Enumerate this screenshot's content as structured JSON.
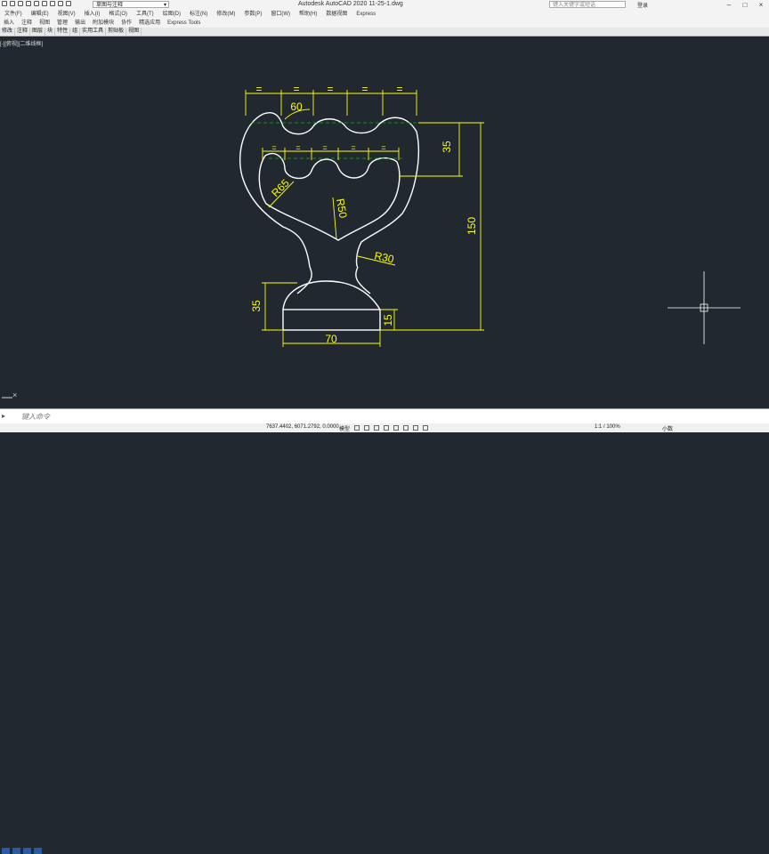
{
  "titlebar": {
    "workspace": "草图与注释",
    "app_title": "Autodesk AutoCAD 2020    11-25-1.dwg",
    "search_placeholder": "键入关键字或短语",
    "login": "登录"
  },
  "menu": [
    "文件(F)",
    "编辑(E)",
    "视图(V)",
    "插入(I)",
    "格式(O)",
    "工具(T)",
    "绘图(D)",
    "标注(N)",
    "修改(M)",
    "参数(P)",
    "窗口(W)",
    "帮助(H)",
    "数据视图",
    "Express"
  ],
  "ribbon_tabs": [
    "插入",
    "注释",
    "视图",
    "管理",
    "输出",
    "附加模块",
    "协作",
    "精选应用",
    "Express Tools"
  ],
  "panels": [
    "修改",
    "注释",
    "图层",
    "块",
    "特性",
    "组",
    "实用工具",
    "剪贴板",
    "视图"
  ],
  "viewport_label": "[-][俯视][二维线框]",
  "drawing": {
    "dim_equal": "=",
    "dim_angle": "60",
    "dim_35_right": "35",
    "dim_150": "150",
    "dim_r65": "R65",
    "dim_r50": "R50",
    "dim_r30": "R30",
    "dim_35_left": "35",
    "dim_15": "15",
    "dim_70": "70"
  },
  "command": {
    "prompt": "键入命令"
  },
  "status": {
    "coords": "7637.4402, 6071.2792, 0.0000",
    "model": "模型",
    "scale": "1:1 / 100%",
    "units": "小数"
  },
  "colors": {
    "background": "#212830",
    "geometry": "#ffffff",
    "dimension": "#ffff00",
    "centerline": "#00c000"
  }
}
